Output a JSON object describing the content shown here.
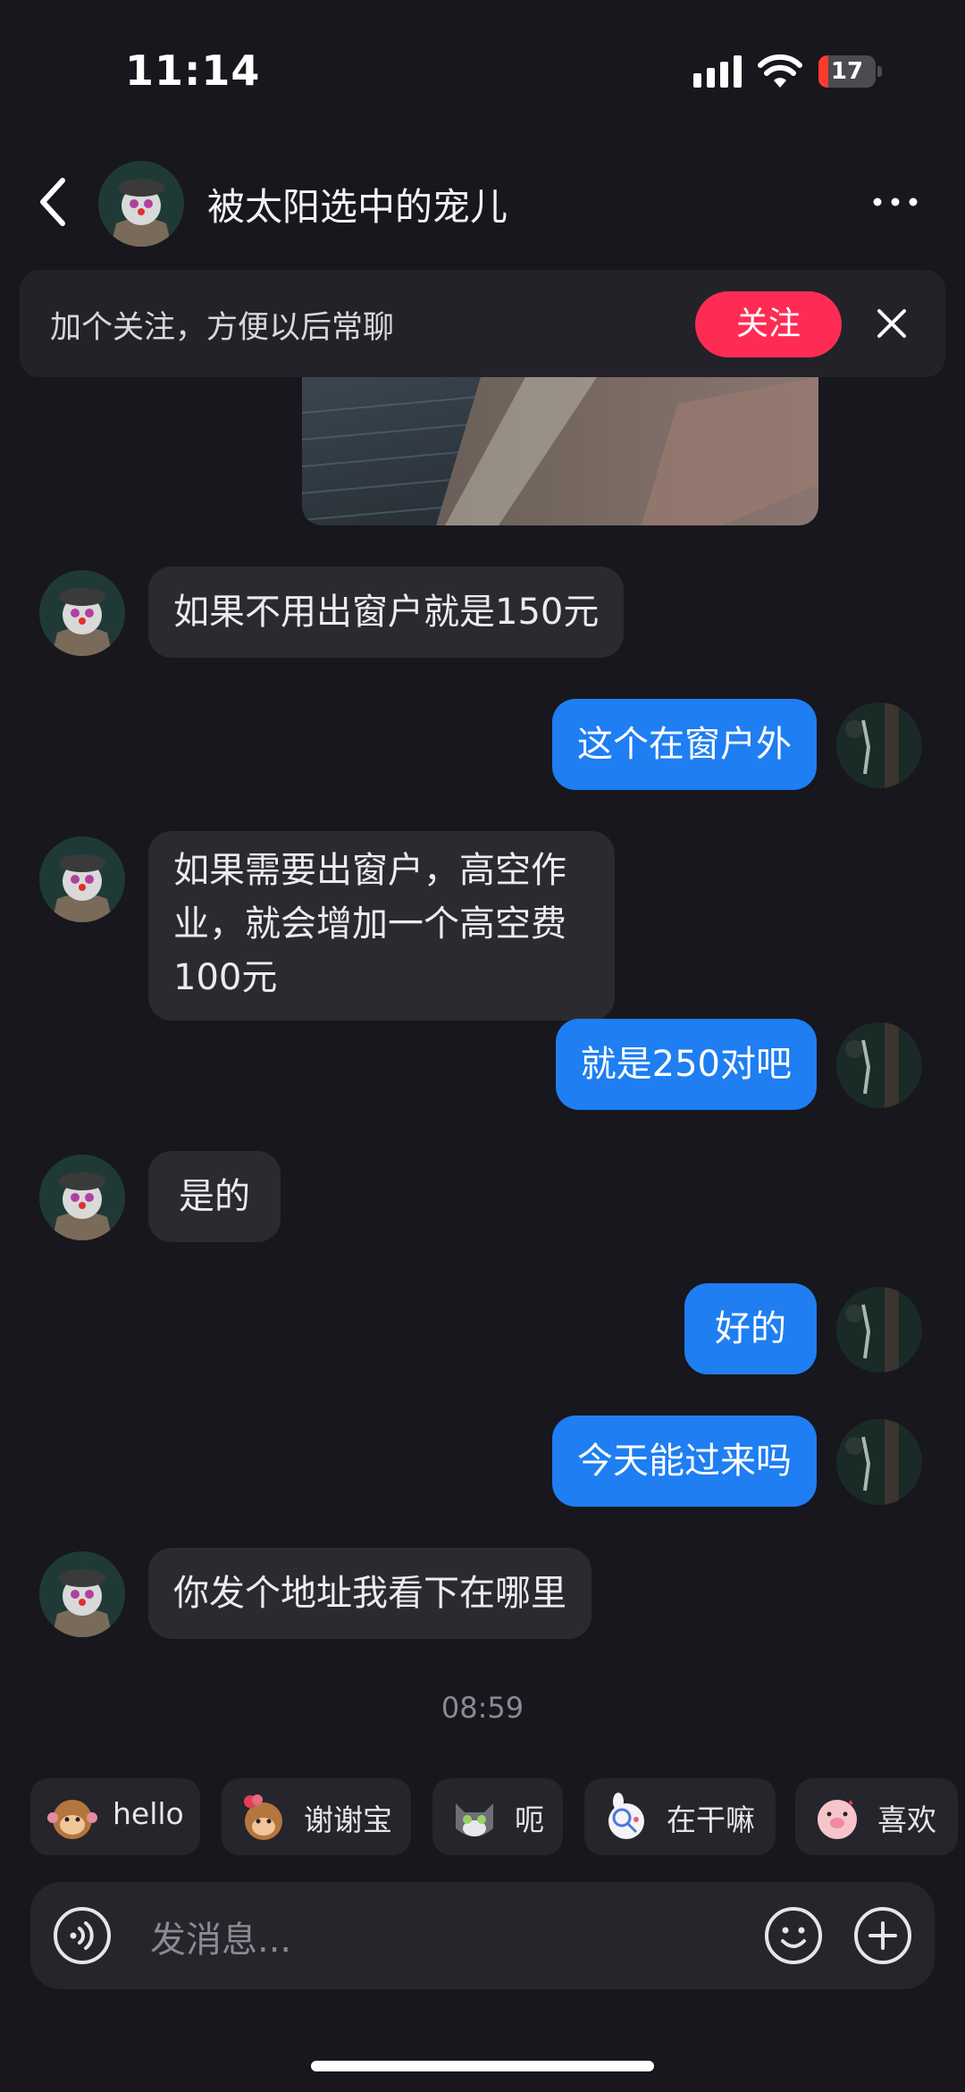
{
  "status_bar": {
    "time": "11:14",
    "battery_level": "17"
  },
  "header": {
    "title": "被太阳选中的宠儿"
  },
  "banner": {
    "text": "加个关注，方便以后常聊",
    "follow_label": "关注"
  },
  "messages": [
    {
      "side": "in",
      "text": "如果不用出窗户就是150元"
    },
    {
      "side": "out",
      "text": "这个在窗户外"
    },
    {
      "side": "in",
      "text": "如果需要出窗户，高空作业，就会增加一个高空费100元"
    },
    {
      "side": "out",
      "text": "就是250对吧"
    },
    {
      "side": "in",
      "text": "是的"
    },
    {
      "side": "out",
      "text": "好的"
    },
    {
      "side": "out",
      "text": "今天能过来吗"
    },
    {
      "side": "in",
      "text": "你发个地址我看下在哪里"
    }
  ],
  "timestamp": "08:59",
  "quick_replies": [
    {
      "label": "hello",
      "icon": "monkey-sticker-icon"
    },
    {
      "label": "谢谢宝",
      "icon": "monkey-flower-sticker-icon"
    },
    {
      "label": "呃",
      "icon": "cat-sticker-icon"
    },
    {
      "label": "在干嘛",
      "icon": "rabbit-sticker-icon"
    },
    {
      "label": "喜欢",
      "icon": "pig-sticker-icon"
    }
  ],
  "input": {
    "placeholder": "发消息..."
  },
  "colors": {
    "background": "#17171d",
    "incoming_bubble": "#2a2a31",
    "outgoing_bubble": "#1e7ef2",
    "follow_button": "#fe2c55"
  }
}
